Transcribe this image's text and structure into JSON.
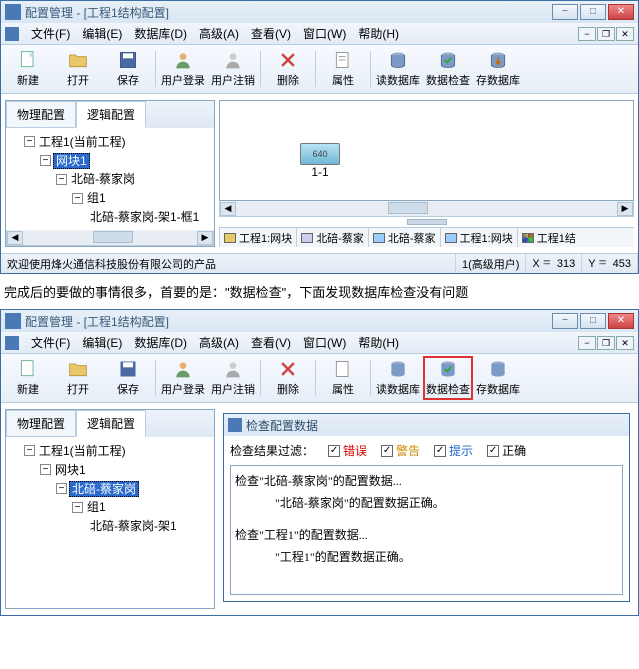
{
  "win1": {
    "title": "配置管理 - [工程1结构配置]",
    "menu": {
      "file": "文件(F)",
      "edit": "编辑(E)",
      "database": "数据库(D)",
      "advanced": "高级(A)",
      "view": "查看(V)",
      "window": "窗口(W)",
      "help": "帮助(H)"
    },
    "toolbar": {
      "new": "新建",
      "open": "打开",
      "save": "保存",
      "login": "用户登录",
      "logout": "用户注销",
      "delete": "删除",
      "props": "属性",
      "readdb": "读数据库",
      "check": "数据检查",
      "savedb": "存数据库"
    },
    "tabs": {
      "phys": "物理配置",
      "logic": "逻辑配置"
    },
    "tree": {
      "root": "工程1(当前工程)",
      "block": "网块1",
      "site": "北碚-蔡家岗",
      "group": "组1",
      "rack": "北碚-蔡家岗-架1-框1"
    },
    "device": {
      "label_top": "640",
      "name": "1-1"
    },
    "bottom_tabs": {
      "t1": "工程1:网块",
      "t2": "北碚-蔡家",
      "t3": "北碚-蔡家",
      "t4": "工程1:网块",
      "t5": "工程1结"
    },
    "status": {
      "welcome": "欢迎使用烽火通信科技股份有限公司的产品",
      "user": "1(高级用户)",
      "x_lbl": "X",
      "x_val": "313",
      "y_lbl": "Y",
      "y_val": "453"
    }
  },
  "paragraph": "完成后的要做的事情很多，首要的是：\"数据检查\"，下面发现数据库检查没有问题",
  "win2": {
    "title": "配置管理 - [工程1结构配置]",
    "tree": {
      "root": "工程1(当前工程)",
      "block": "网块1",
      "site": "北碚-蔡家岗",
      "group": "组1",
      "rack": "北碚-蔡家岗-架1"
    },
    "dialog": {
      "title": "检查配置数据",
      "filter_label": "检查结果过滤：",
      "f_error": "错误",
      "f_warn": "警告",
      "f_hint": "提示",
      "f_ok": "正确",
      "lines": {
        "l1": "检查\"北碚-蔡家岗\"的配置数据...",
        "l2": "\"北碚-蔡家岗\"的配置数据正确。",
        "l3": "检查\"工程1\"的配置数据...",
        "l4": "\"工程1\"的配置数据正确。"
      }
    }
  },
  "glyphs": {
    "eq": "=",
    "minus": "−",
    "dash": "—",
    "x": "✕",
    "check": "✓",
    "left": "◀",
    "right": "▶"
  }
}
